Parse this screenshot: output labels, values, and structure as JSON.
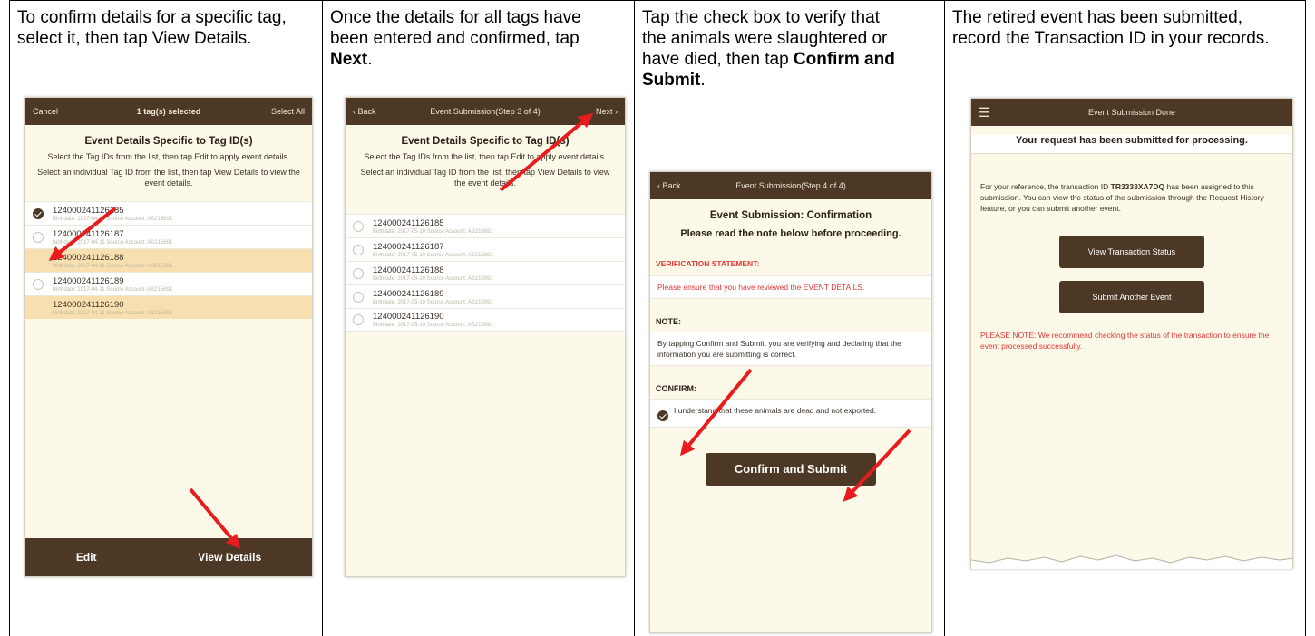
{
  "columns": [
    {
      "instruction": [
        {
          "t": "To confirm details for a specific tag, select it, then tap View Details.",
          "b": false
        }
      ]
    },
    {
      "instruction": [
        {
          "t": "Once the details for all tags have been entered and confirmed, tap ",
          "b": false
        },
        {
          "t": "Next",
          "b": true
        },
        {
          "t": ".",
          "b": false
        }
      ]
    },
    {
      "instruction": [
        {
          "t": "Tap the check box to verify that the animals were slaughtered or have died, then tap ",
          "b": false
        },
        {
          "t": "Confirm and Submit",
          "b": true
        },
        {
          "t": ".",
          "b": false
        }
      ]
    },
    {
      "instruction": [
        {
          "t": "The retired event has been submitted, record the Transaction ID in your records.",
          "b": false
        }
      ]
    }
  ],
  "screen1": {
    "nav_left": "Cancel",
    "nav_title": "1 tag(s) selected",
    "nav_right": "Select All",
    "heading": "Event Details Specific to Tag ID(s)",
    "line1": "Select the Tag IDs from the list, then tap Edit to apply event details.",
    "line2": "Select an individual Tag ID from the list, then tap View Details to view the event details.",
    "tags": [
      {
        "id": "124000241126185",
        "sub": "Birthdate: 2017-04-11 Source Account: AS215691",
        "selected": true,
        "highlight": false
      },
      {
        "id": "124000241126187",
        "sub": "Birthdate: 2017-04-11 Source Account: AS215691",
        "selected": false,
        "highlight": false
      },
      {
        "id": "124000241126188",
        "sub": "Birthdate: 2017-04-11 Source Account: AS215691",
        "selected": false,
        "highlight": true
      },
      {
        "id": "124000241126189",
        "sub": "Birthdate: 2017-04-11 Source Account: AS215691",
        "selected": false,
        "highlight": false
      },
      {
        "id": "124000241126190",
        "sub": "Birthdate: 2017-04-11 Source Account: AS215691",
        "selected": false,
        "highlight": true
      }
    ],
    "edit_label": "Edit",
    "view_details_label": "View Details"
  },
  "screen2": {
    "nav_left": "Back",
    "nav_title": "Event Submission(Step 3 of 4)",
    "nav_right": "Next",
    "heading": "Event Details Specific to Tag ID(s)",
    "line1": "Select the Tag IDs from the list, then tap Edit to apply event details.",
    "line2": "Select an individual Tag ID from the list, then tap View Details to view the event details.",
    "tags": [
      {
        "id": "124000241126185",
        "sub": "Birthdate: 2017-05-10 Source Account: AS215691"
      },
      {
        "id": "124000241126187",
        "sub": "Birthdate: 2017-05-10 Source Account: AS215691"
      },
      {
        "id": "124000241126188",
        "sub": "Birthdate: 2017-05-10 Source Account: AS215691"
      },
      {
        "id": "124000241126189",
        "sub": "Birthdate: 2017-05-10 Source Account: AS215691"
      },
      {
        "id": "124000241126190",
        "sub": "Birthdate: 2017-05-10 Source Account: AS215691"
      }
    ]
  },
  "screen3": {
    "nav_left": "Back",
    "nav_title": "Event Submission(Step 4 of 4)",
    "heading": "Event Submission: Confirmation",
    "subheading": "Please read the note below before proceeding.",
    "verification_label": "VERIFICATION STATEMENT:",
    "verification_text": "Please ensure that you have reviewed the EVENT DETAILS.",
    "note_label": "NOTE:",
    "note_text": "By tapping Confirm and Submit, you are verifying and declaring that the information you are submitting is correct.",
    "confirm_label": "CONFIRM:",
    "confirm_text": "I understand that these animals are dead and not exported.",
    "submit_label": "Confirm and Submit"
  },
  "screen4": {
    "nav_title": "Event Submission Done",
    "heading": "Your request has been submitted for processing.",
    "ref_prefix": "For your reference, the transaction ID ",
    "transaction_id": "TR3333XA7DQ",
    "ref_suffix": " has been assigned to this submission. You can view the status of the submission through the Request History feature, or you can submit another event.",
    "view_status_label": "View Transaction Status",
    "submit_another_label": "Submit Another Event",
    "please_note": "PLEASE NOTE: We recommend checking the status of the transaction to ensure the event processed successfully."
  },
  "colors": {
    "brand_brown": "#4d3826",
    "screen_bg": "#fcf9e9",
    "highlight_row": "#f7dfb0",
    "alert_red": "#e23838",
    "arrow_red": "#e81c1c"
  }
}
